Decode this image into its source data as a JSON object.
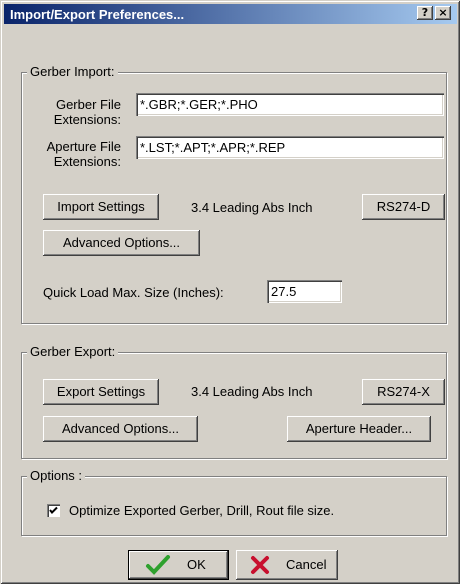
{
  "window": {
    "title": "Import/Export Preferences...",
    "help_glyph": "?",
    "close_glyph": "×"
  },
  "gerber_import": {
    "legend": "Gerber Import:",
    "file_ext_label": "Gerber File Extensions:",
    "file_ext_value": "*.GBR;*.GER;*.PHO",
    "aperture_ext_label": "Aperture File Extensions:",
    "aperture_ext_value": "*.LST;*.APT;*.APR;*.REP",
    "import_settings_button": "Import Settings",
    "format_text": "3.4 Leading Abs Inch",
    "format_button": "RS274-D",
    "advanced_button": "Advanced Options...",
    "quick_load_label": "Quick Load Max. Size (Inches):",
    "quick_load_value": "27.5"
  },
  "gerber_export": {
    "legend": "Gerber Export:",
    "export_settings_button": "Export Settings",
    "format_text": "3.4 Leading Abs Inch",
    "format_button": "RS274-X",
    "advanced_button": "Advanced Options...",
    "aperture_header_button": "Aperture Header..."
  },
  "options": {
    "legend": "Options :",
    "optimize_label": "Optimize Exported Gerber, Drill, Rout file size.",
    "optimize_checked": true
  },
  "footer": {
    "ok_label": "OK",
    "cancel_label": "Cancel"
  },
  "colors": {
    "ok_check": "#2ea12e",
    "cancel_x": "#c8102e"
  }
}
